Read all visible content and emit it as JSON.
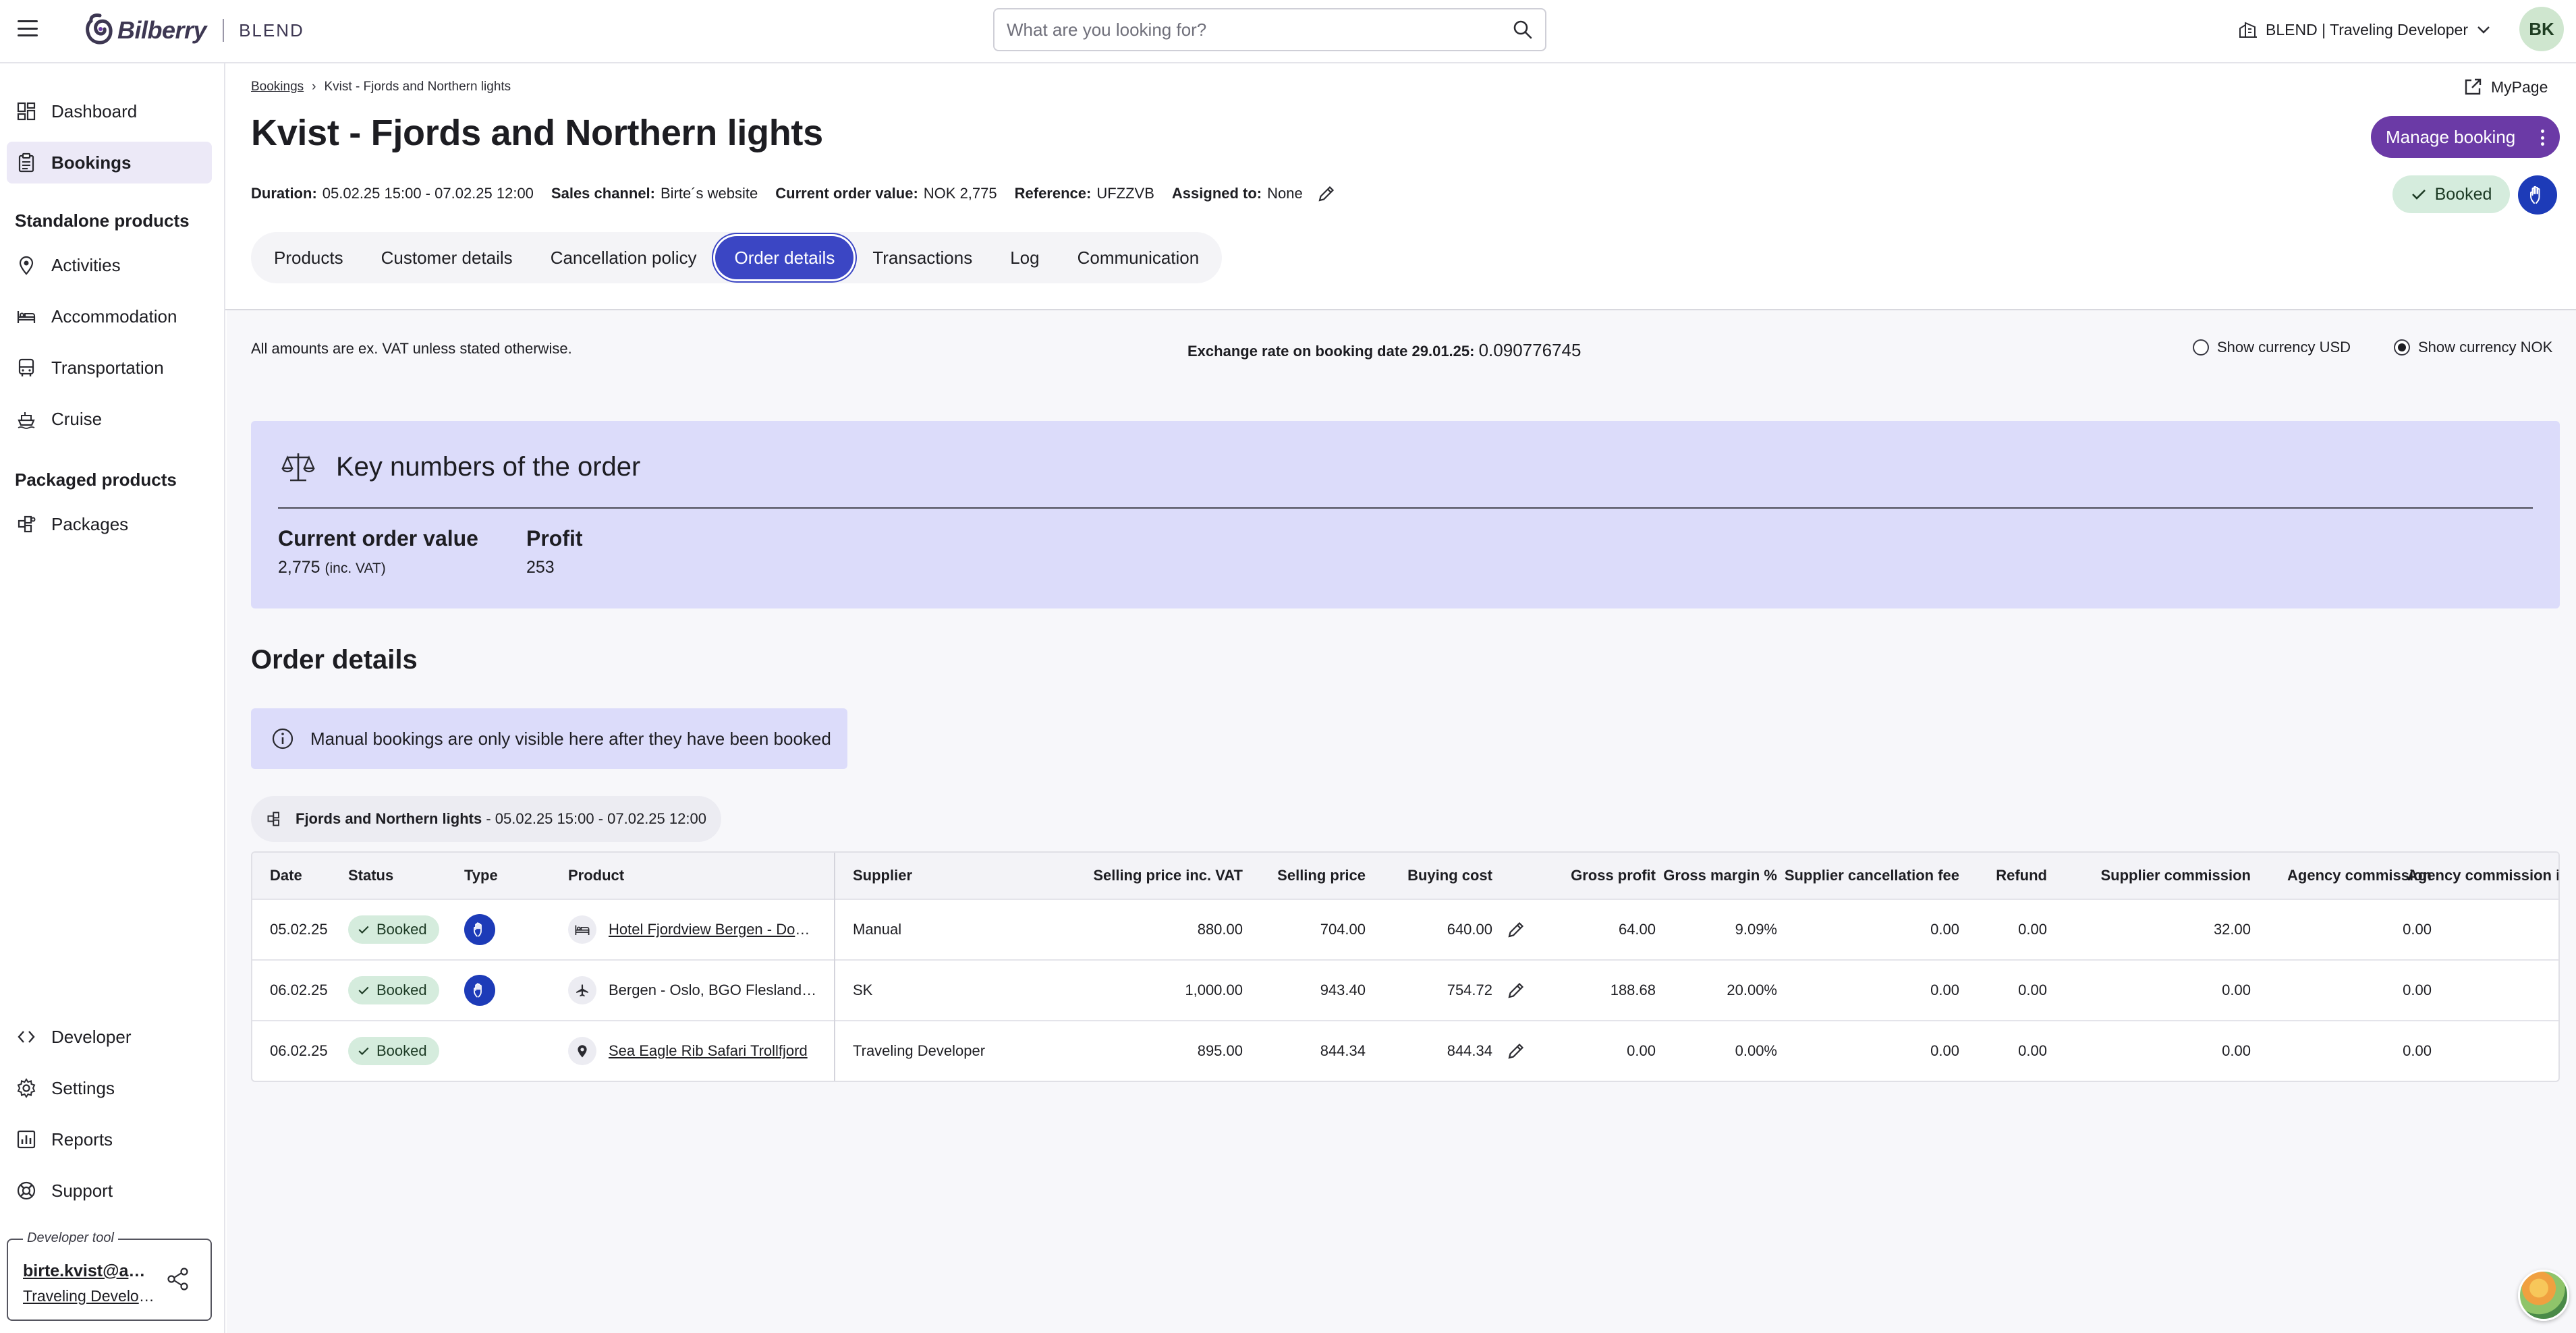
{
  "header": {
    "brand": "Bilberry",
    "product": "BLEND",
    "search_placeholder": "What are you looking for?",
    "org_selector": "BLEND | Traveling Developer",
    "avatar_initials": "BK"
  },
  "sidebar": {
    "items_top": [
      {
        "label": "Dashboard",
        "icon": "dashboard-icon"
      },
      {
        "label": "Bookings",
        "icon": "clipboard-icon",
        "active": true
      }
    ],
    "standalone_heading": "Standalone products",
    "standalone_items": [
      {
        "label": "Activities",
        "icon": "location-pin-icon"
      },
      {
        "label": "Accommodation",
        "icon": "bed-icon"
      },
      {
        "label": "Transportation",
        "icon": "bus-icon"
      },
      {
        "label": "Cruise",
        "icon": "ship-icon"
      }
    ],
    "packaged_heading": "Packaged products",
    "packaged_items": [
      {
        "label": "Packages",
        "icon": "packages-icon"
      }
    ],
    "items_bottom": [
      {
        "label": "Developer",
        "icon": "code-icon"
      },
      {
        "label": "Settings",
        "icon": "gear-icon"
      },
      {
        "label": "Reports",
        "icon": "chart-icon"
      },
      {
        "label": "Support",
        "icon": "lifebuoy-icon"
      }
    ],
    "developer_tool": {
      "legend": "Developer tool",
      "email": "birte.kvist@adventures.no",
      "org": "Traveling Developer"
    }
  },
  "page": {
    "breadcrumb_root": "Bookings",
    "breadcrumb_current": "Kvist - Fjords and Northern lights",
    "mypage": "MyPage",
    "title": "Kvist - Fjords and Northern lights",
    "manage_button": "Manage booking",
    "status": "Booked",
    "meta": {
      "duration_label": "Duration:",
      "duration": "05.02.25 15:00 - 07.02.25 12:00",
      "sales_channel_label": "Sales channel:",
      "sales_channel": "Birte´s website",
      "order_value_label": "Current order value:",
      "order_value": "NOK 2,775",
      "reference_label": "Reference:",
      "reference": "UFZZVB",
      "assigned_label": "Assigned to:",
      "assigned": "None"
    },
    "tabs": [
      "Products",
      "Customer details",
      "Cancellation policy",
      "Order details",
      "Transactions",
      "Log",
      "Communication"
    ],
    "active_tab": "Order details"
  },
  "order": {
    "vat_note": "All amounts are ex. VAT unless stated otherwise.",
    "exchange_label": "Exchange rate on booking date 29.01.25:",
    "exchange_value": "0.090776745",
    "currency_usd": "Show currency USD",
    "currency_nok": "Show currency NOK",
    "selected_currency": "NOK",
    "key_numbers_title": "Key numbers of the order",
    "current_order_value_label": "Current order value",
    "current_order_value": "2,775",
    "current_order_value_suffix": "(inc. VAT)",
    "profit_label": "Profit",
    "profit": "253",
    "section_title": "Order details",
    "info_banner": "Manual bookings are only visible here after they have been booked",
    "group_name": "Fjords and Northern lights",
    "group_dates": " - 05.02.25 15:00 - 07.02.25 12:00"
  },
  "table": {
    "columns": [
      "Date",
      "Status",
      "Type",
      "Product",
      "Supplier",
      "Selling price inc. VAT",
      "Selling price",
      "Buying cost",
      "Gross profit",
      "Gross margin %",
      "Supplier cancellation fee",
      "Refund",
      "Supplier commission",
      "Agency commission",
      "Agency commission inc. VAT"
    ],
    "rows": [
      {
        "date": "05.02.25",
        "status": "Booked",
        "manual": true,
        "product_icon": "bed-icon",
        "product": "Hotel Fjordview Bergen - Double room",
        "product_link": true,
        "supplier": "Manual",
        "selling_inc_vat": "880.00",
        "selling": "704.00",
        "buying": "640.00",
        "gross_profit": "64.00",
        "gross_margin": "9.09%",
        "supplier_cancel_fee": "0.00",
        "refund": "0.00",
        "supplier_commission": "32.00",
        "agency_commission": "0.00"
      },
      {
        "date": "06.02.25",
        "status": "Booked",
        "manual": true,
        "product_icon": "plane-icon",
        "product": "Bergen - Oslo, BGO Flesland - OSL Gardermoen",
        "product_link": false,
        "supplier": "SK",
        "selling_inc_vat": "1,000.00",
        "selling": "943.40",
        "buying": "754.72",
        "gross_profit": "188.68",
        "gross_margin": "20.00%",
        "supplier_cancel_fee": "0.00",
        "refund": "0.00",
        "supplier_commission": "0.00",
        "agency_commission": "0.00"
      },
      {
        "date": "06.02.25",
        "status": "Booked",
        "manual": false,
        "product_icon": "location-pin-icon",
        "product": "Sea Eagle Rib Safari Trollfjord",
        "product_link": true,
        "supplier": "Traveling Developer",
        "selling_inc_vat": "895.00",
        "selling": "844.34",
        "buying": "844.34",
        "gross_profit": "0.00",
        "gross_margin": "0.00%",
        "supplier_cancel_fee": "0.00",
        "refund": "0.00",
        "supplier_commission": "0.00",
        "agency_commission": "0.00"
      }
    ]
  },
  "colors": {
    "accent_purple": "#6b3aa6",
    "tab_active": "#3b46c4",
    "manual_blue": "#1d3bb8",
    "status_green_bg": "#d5ecdd",
    "card_lavender": "#dcdcfa"
  }
}
